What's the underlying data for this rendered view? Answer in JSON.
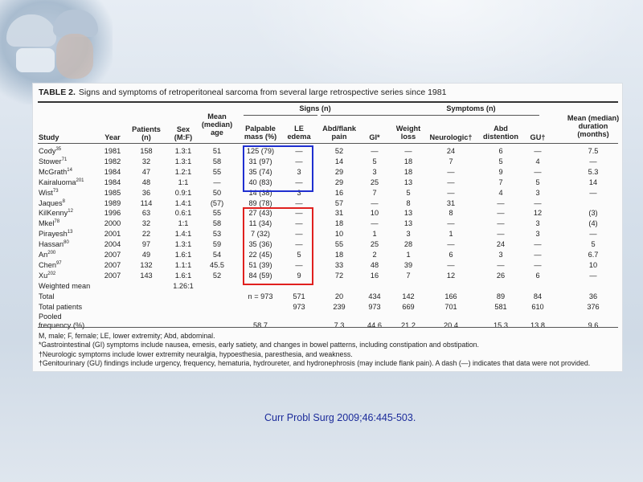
{
  "table": {
    "label": "TABLE 2.",
    "title": "Signs and symptoms of retroperitoneal sarcoma from several large retrospective series since 1981",
    "group_signs": "Signs (n)",
    "group_symptoms": "Symptoms (n)",
    "columns": [
      {
        "key": "study",
        "label": "Study"
      },
      {
        "key": "year",
        "label": "Year"
      },
      {
        "key": "patients",
        "label": "Patients (n)"
      },
      {
        "key": "sex",
        "label": "Sex (M:F)"
      },
      {
        "key": "age",
        "label": "Mean (median) age"
      },
      {
        "key": "mass",
        "label": "Palpable mass (%)"
      },
      {
        "key": "le",
        "label": "LE edema"
      },
      {
        "key": "abd",
        "label": "Abd/flank pain"
      },
      {
        "key": "gi",
        "label": "GI*"
      },
      {
        "key": "wt",
        "label": "Weight loss"
      },
      {
        "key": "neuro",
        "label": "Neurologic†"
      },
      {
        "key": "dist",
        "label": "Abd distention"
      },
      {
        "key": "gu",
        "label": "GU†"
      },
      {
        "key": "dur",
        "label": "Mean (median) duration (months)"
      }
    ],
    "rows": [
      {
        "study": "Cody",
        "ref": "35",
        "year": "1981",
        "patients": "158",
        "sex": "1.3:1",
        "age": "51",
        "mass": "125 (79)",
        "le": "—",
        "abd": "52",
        "gi": "—",
        "wt": "—",
        "neuro": "24",
        "dist": "6",
        "gu": "—",
        "dur": "7.5"
      },
      {
        "study": "Stower",
        "ref": "71",
        "year": "1982",
        "patients": "32",
        "sex": "1.3:1",
        "age": "58",
        "mass": "31 (97)",
        "le": "—",
        "abd": "14",
        "gi": "5",
        "wt": "18",
        "neuro": "7",
        "dist": "5",
        "gu": "4",
        "dur": "—"
      },
      {
        "study": "McGrath",
        "ref": "14",
        "year": "1984",
        "patients": "47",
        "sex": "1.2:1",
        "age": "55",
        "mass": "35 (74)",
        "le": "3",
        "abd": "29",
        "gi": "3",
        "wt": "18",
        "neuro": "—",
        "dist": "9",
        "gu": "—",
        "dur": "5.3"
      },
      {
        "study": "Kairaluoma",
        "ref": "201",
        "year": "1984",
        "patients": "48",
        "sex": "1:1",
        "age": "—",
        "mass": "40 (83)",
        "le": "—",
        "abd": "29",
        "gi": "25",
        "wt": "13",
        "neuro": "—",
        "dist": "7",
        "gu": "5",
        "dur": "14"
      },
      {
        "study": "Wist",
        "ref": "73",
        "year": "1985",
        "patients": "36",
        "sex": "0.9:1",
        "age": "50",
        "mass": "14 (38)",
        "le": "3",
        "abd": "16",
        "gi": "7",
        "wt": "5",
        "neuro": "—",
        "dist": "4",
        "gu": "3",
        "dur": "—"
      },
      {
        "study": "Jaques",
        "ref": "8",
        "year": "1989",
        "patients": "114",
        "sex": "1.4:1",
        "age": "(57)",
        "mass": "89 (78)",
        "le": "—",
        "abd": "57",
        "gi": "—",
        "wt": "8",
        "neuro": "31",
        "dist": "—",
        "gu": "—",
        "dur": ""
      },
      {
        "study": "KilKenny",
        "ref": "12",
        "year": "1996",
        "patients": "63",
        "sex": "0.6:1",
        "age": "55",
        "mass": "27 (43)",
        "le": "—",
        "abd": "31",
        "gi": "10",
        "wt": "13",
        "neuro": "8",
        "dist": "—",
        "gu": "12",
        "dur": "(3)"
      },
      {
        "study": "Mkel",
        "ref": "78",
        "year": "2000",
        "patients": "32",
        "sex": "1:1",
        "age": "58",
        "mass": "11 (34)",
        "le": "—",
        "abd": "18",
        "gi": "—",
        "wt": "13",
        "neuro": "—",
        "dist": "—",
        "gu": "3",
        "dur": "(4)"
      },
      {
        "study": "Pirayesh",
        "ref": "13",
        "year": "2001",
        "patients": "22",
        "sex": "1.4:1",
        "age": "53",
        "mass": "7 (32)",
        "le": "—",
        "abd": "10",
        "gi": "1",
        "wt": "3",
        "neuro": "1",
        "dist": "—",
        "gu": "3",
        "dur": "—"
      },
      {
        "study": "Hassan",
        "ref": "80",
        "year": "2004",
        "patients": "97",
        "sex": "1.3:1",
        "age": "59",
        "mass": "35 (36)",
        "le": "—",
        "abd": "55",
        "gi": "25",
        "wt": "28",
        "neuro": "—",
        "dist": "24",
        "gu": "—",
        "dur": "5"
      },
      {
        "study": "An",
        "ref": "200",
        "year": "2007",
        "patients": "49",
        "sex": "1.6:1",
        "age": "54",
        "mass": "22 (45)",
        "le": "5",
        "abd": "18",
        "gi": "2",
        "wt": "1",
        "neuro": "6",
        "dist": "3",
        "gu": "—",
        "dur": "6.7"
      },
      {
        "study": "Chen",
        "ref": "97",
        "year": "2007",
        "patients": "132",
        "sex": "1.1:1",
        "age": "45.5",
        "mass": "51 (39)",
        "le": "—",
        "abd": "33",
        "gi": "48",
        "wt": "39",
        "neuro": "—",
        "dist": "—",
        "gu": "—",
        "dur": "10"
      },
      {
        "study": "Xu",
        "ref": "202",
        "year": "2007",
        "patients": "143",
        "sex": "1.6:1",
        "age": "52",
        "mass": "84 (59)",
        "le": "9",
        "abd": "72",
        "gi": "16",
        "wt": "7",
        "neuro": "12",
        "dist": "26",
        "gu": "6",
        "dur": "—"
      }
    ],
    "summary": [
      {
        "study": "Weighted mean",
        "sex": "1.26:1"
      },
      {
        "study": "Total",
        "mass": "n = 973",
        "le": "571",
        "abd": "20",
        "gi": "434",
        "wt": "142",
        "neuro": "166",
        "dist": "89",
        "gu": "84",
        "dur": "36"
      },
      {
        "study": "Total patients",
        "le": "973",
        "abd": "239",
        "gi": "973",
        "wt": "669",
        "neuro": "701",
        "dist": "581",
        "gu": "610",
        "dur": "376"
      },
      {
        "study": "Pooled",
        "study2": "frequency (%)",
        "mass": "58.7",
        "abd": "7.3",
        "gi": "44.6",
        "wt": "21.2",
        "neuro": "20.4",
        "dist": "15.3",
        "gu": "13.8",
        "dur": "9.6"
      }
    ],
    "footnotes": [
      "M, male; F, female; LE, lower extremity; Abd, abdominal.",
      "*Gastrointestinal (GI) symptoms include nausea, emesis, early satiety, and changes in bowel patterns, including constipation and obstipation.",
      "†Neurologic symptoms include lower extremity neuralgia, hypoesthesia, paresthesia, and weakness.",
      "†Genitourinary (GU) findings include urgency, frequency, hematuria, hydroureter, and hydronephrosis (may include flank pain). A dash (—) indicates that data were not provided."
    ],
    "highlight_colors": {
      "blue": "#1f2fd0",
      "red": "#e0201e"
    }
  },
  "citation": "Curr Probl Surg 2009;46:445-503."
}
